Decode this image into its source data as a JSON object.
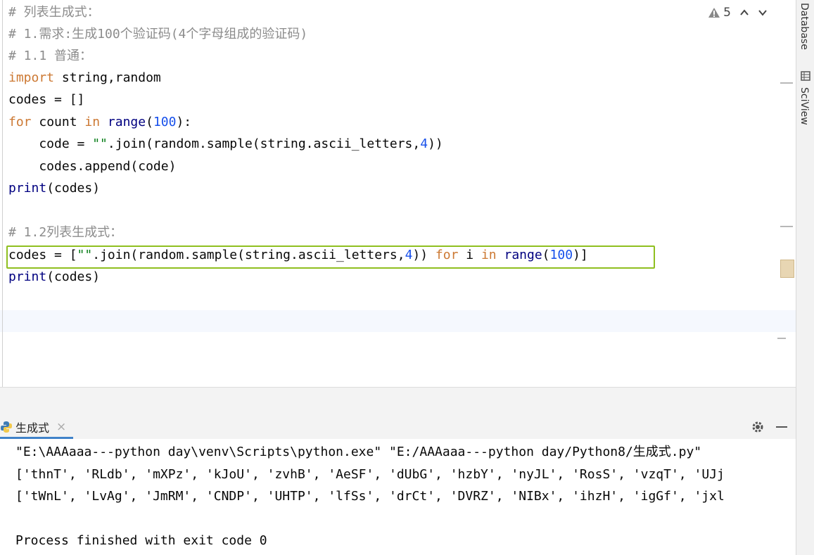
{
  "editor": {
    "warning_count": "5",
    "lines": {
      "l1": "# 列表生成式：",
      "l2": "# 1.需求:生成100个验证码(4个字母组成的验证码)",
      "l3": "# 1.1 普通：",
      "l4_kw": "import",
      "l4_rest": " string",
      "l4_comma": ",",
      "l4_end": "random",
      "l5": "codes = []",
      "l6_kw": "for",
      "l6_a": " count ",
      "l6_in": "in",
      "l6_sp": " ",
      "l6_range": "range",
      "l6_p1": "(",
      "l6_num": "100",
      "l6_p2": "):",
      "l7_a": "    code = ",
      "l7_str": "\"\"",
      "l7_b": ".join(random.sample(string.ascii_letters",
      "l7_comma": ",",
      "l7_num": "4",
      "l7_c": "))",
      "l8": "    codes.append(code)",
      "l9_print": "print",
      "l9_rest": "(codes)",
      "l11": "# 1.2列表生成式：",
      "l12_a": "codes = [",
      "l12_str": "\"\"",
      "l12_b": ".join(random.sample(string.ascii_letters",
      "l12_comma": ",",
      "l12_num": "4",
      "l12_c": ")) ",
      "l12_for": "for",
      "l12_i": " i ",
      "l12_in": "in",
      "l12_sp": " ",
      "l12_range": "range",
      "l12_p1": "(",
      "l12_num2": "100",
      "l12_p2": ")]",
      "l13_print": "print",
      "l13_rest": "(codes)"
    }
  },
  "right_tabs": {
    "database": "Database",
    "sciview": "SciView"
  },
  "run_panel": {
    "tab_label": "生成式",
    "console_lines": [
      "\"E:\\AAAaaa---python day\\venv\\Scripts\\python.exe\" \"E:/AAAaaa---python day/Python8/生成式.py\"",
      "['thnT', 'RLdb', 'mXPz', 'kJoU', 'zvhB', 'AeSF', 'dUbG', 'hzbY', 'nyJL', 'RosS', 'vzqT', 'UJj",
      "['tWnL', 'LvAg', 'JmRM', 'CNDP', 'UHTP', 'lfSs', 'drCt', 'DVRZ', 'NIBx', 'ihzH', 'igGf', 'jxl",
      "",
      "Process finished with exit code 0"
    ]
  },
  "colors": {
    "keyword": "#cc7832",
    "builtin": "#000080",
    "number": "#1750eb",
    "string": "#067d17",
    "highlight_border": "#8fbf1f",
    "tab_accent": "#4083c9"
  }
}
